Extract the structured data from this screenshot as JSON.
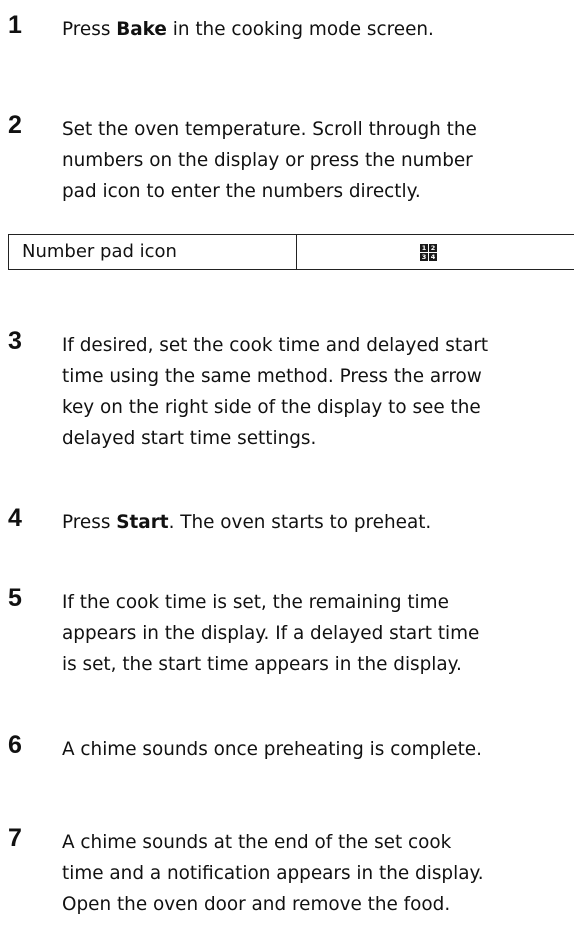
{
  "steps": [
    {
      "num": "1",
      "pre": "Press ",
      "bold": "Bake",
      "post": " in the cooking mode screen."
    },
    {
      "num": "2",
      "lines": [
        "Set the oven temperature. Scroll through the",
        "numbers on the display or press the number",
        "pad icon to enter the numbers directly."
      ]
    },
    {
      "num": "3",
      "lines": [
        "If desired, set the cook time and delayed start",
        "time using the same method. Press the arrow",
        "key on the right side of the display to see the",
        "delayed start time settings."
      ]
    },
    {
      "num": "4",
      "pre": "Press ",
      "bold": "Start",
      "post": ". The oven starts to preheat."
    },
    {
      "num": "5",
      "lines": [
        "If the cook time is set, the remaining time",
        "appears in the display. If a delayed start time",
        "is set, the start time appears in the display."
      ]
    },
    {
      "num": "6",
      "lines": [
        "A chime sounds once preheating is complete."
      ]
    },
    {
      "num": "7",
      "lines": [
        "A chime sounds at the end of the set cook",
        "time and a notification appears in the display.",
        "Open the oven door and remove the food."
      ]
    }
  ],
  "icon_table": {
    "label": "Number pad icon",
    "icon": "number-pad-icon",
    "icon_digits": [
      "1",
      "2",
      "3",
      "4"
    ]
  }
}
